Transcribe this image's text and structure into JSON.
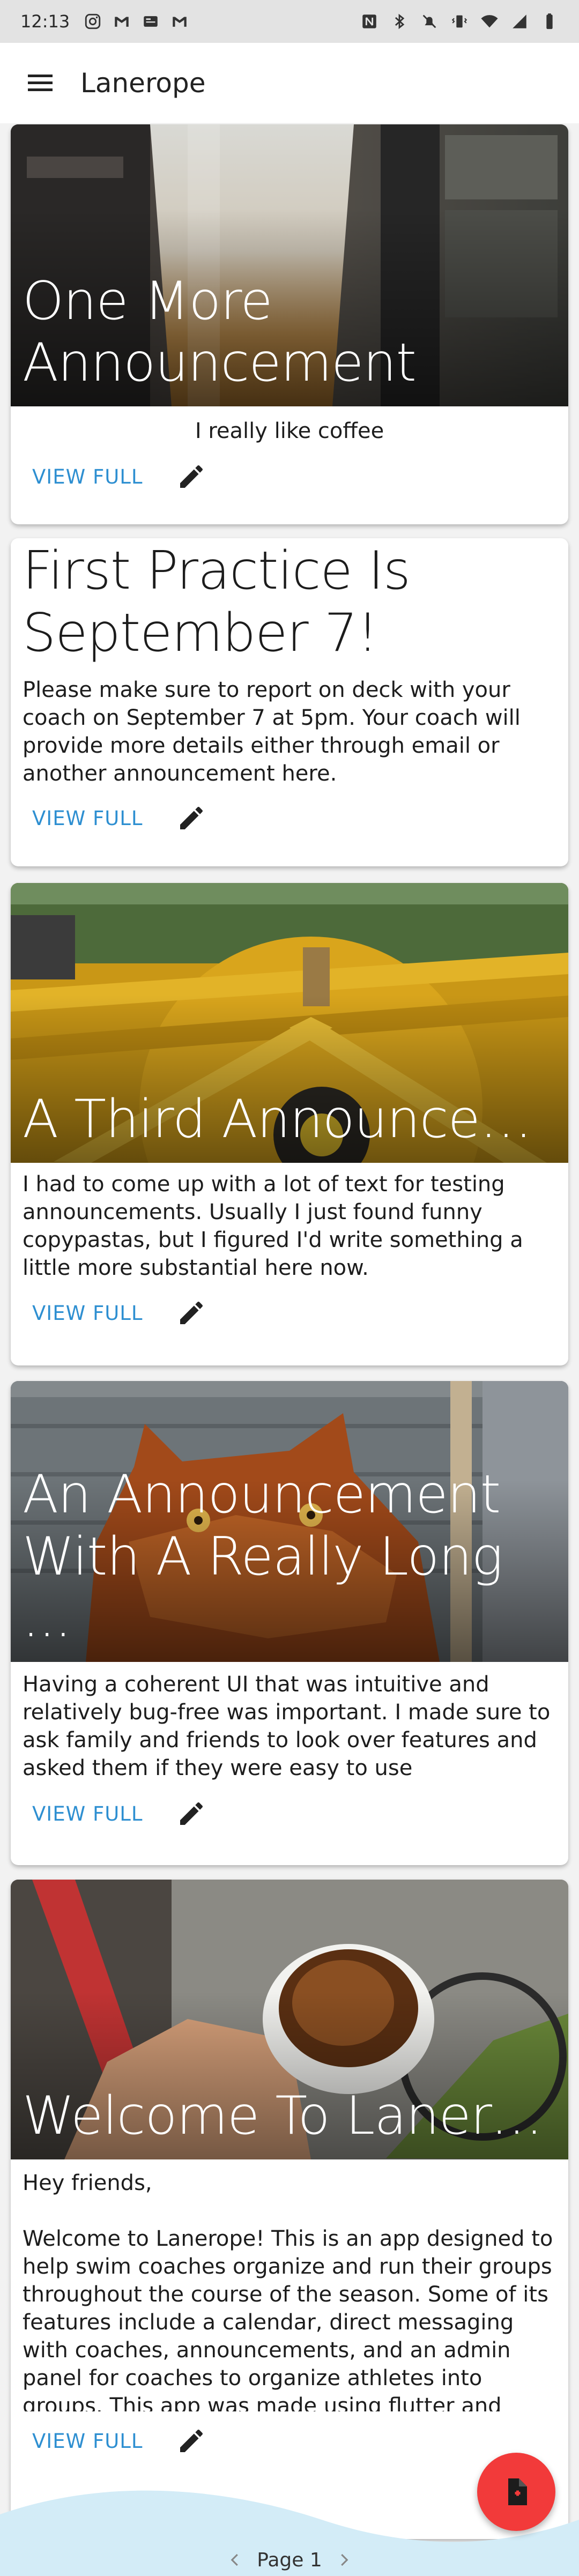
{
  "status_bar": {
    "time": "12:13",
    "left_icons": [
      "instagram-icon",
      "gmail-icon",
      "news-icon",
      "gmail-icon"
    ],
    "right_icons": [
      "nfc-icon",
      "bluetooth-icon",
      "mute-icon",
      "vibrate-icon",
      "wifi-icon",
      "signal-icon",
      "battery-icon"
    ]
  },
  "app_bar": {
    "title": "Lanerope",
    "menu_icon": "hamburger-menu-icon"
  },
  "announcements": [
    {
      "title": "One More Announcement",
      "body": "I really like coffee",
      "has_image": true,
      "image": "iced-coffee-photo",
      "view_label": "VIEW FULL"
    },
    {
      "title": "First Practice Is September 7!",
      "body": "Please make sure to report on deck with your coach on September 7 at 5pm. Your coach will provide more details either through email or another announcement here.",
      "has_image": false,
      "view_label": "VIEW FULL"
    },
    {
      "title": "A Third Announcement",
      "body": "I had to come up with a lot of text for testing announcements. Usually I just found funny copypastas, but I figured I'd write something a little more substantial here now.",
      "has_image": true,
      "image": "yellow-structure-photo",
      "view_label": "VIEW FULL"
    },
    {
      "title": "An Announcement With A Really Long ...",
      "body": "Having a coherent UI that was intuitive and relatively bug-free was important. I made sure to ask family and friends to look over features and asked them if they were easy to use",
      "has_image": true,
      "image": "cat-photo",
      "view_label": "VIEW FULL"
    },
    {
      "title": "Welcome To Lanerope!",
      "body_intro": "Hey friends,",
      "body": "Welcome to Lanerope! This is an app designed to help swim coaches organize and run their groups throughout the course of the season. Some of its features include a calendar, direct messaging with coaches, announcements, and an admin panel for coaches to organize athletes into groups. This app was made using flutter and dart, and coded in Android Studio. It uses Firebase for all database",
      "has_image": true,
      "image": "espresso-cup-photo",
      "view_label": "VIEW FULL"
    }
  ],
  "pagination": {
    "label": "Page 1"
  },
  "fab": {
    "icon": "add-document-icon"
  },
  "colors": {
    "accent": "#2e8fd1",
    "fab": "#f23a3a",
    "wave": "#d3ecf7"
  }
}
